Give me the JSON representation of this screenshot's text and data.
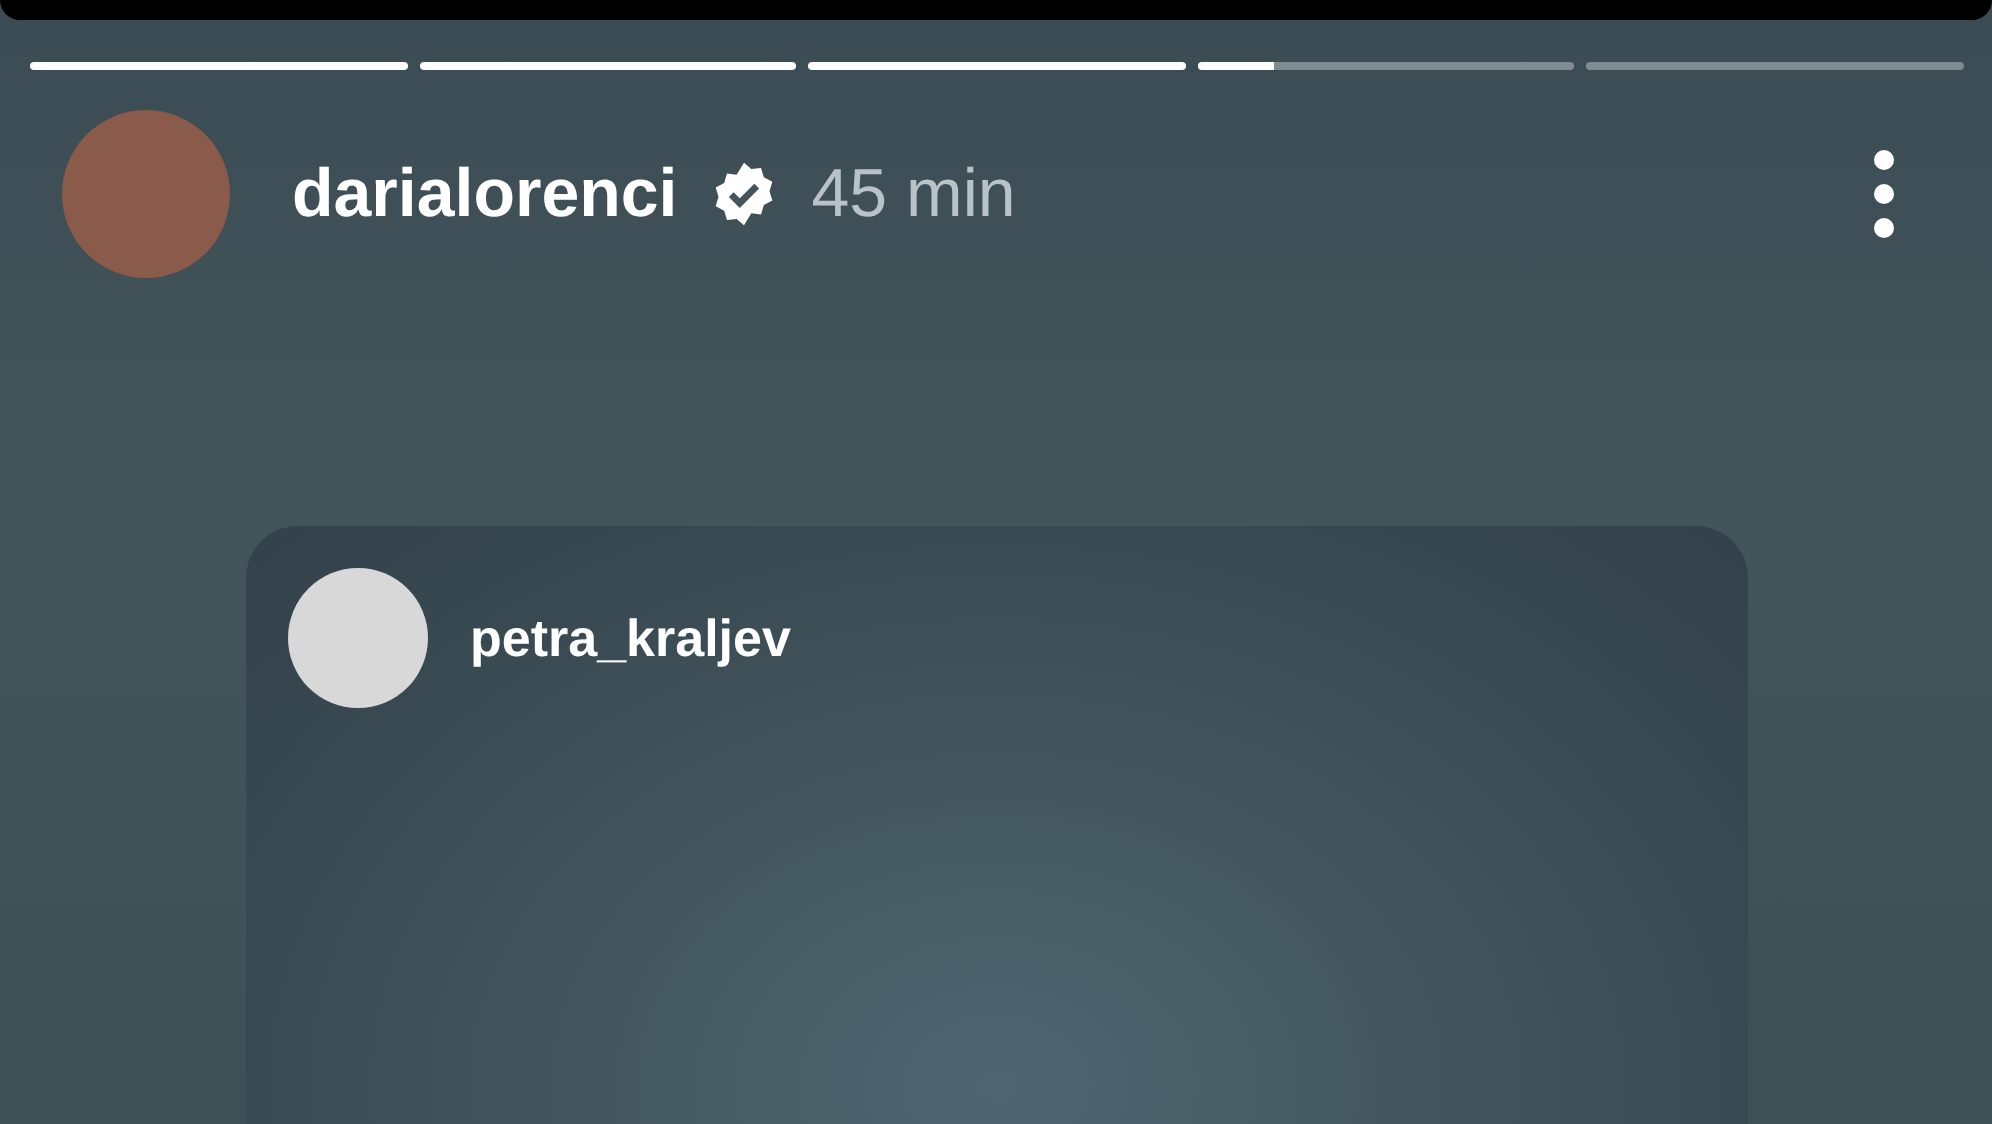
{
  "progress": [
    {
      "level": 1
    },
    {
      "level": 1
    },
    {
      "level": 1
    },
    {
      "level": 0.2
    },
    {
      "level": 0
    }
  ],
  "header": {
    "username": "darialorenci",
    "verified": true,
    "time": "45 min"
  },
  "shared_post": {
    "username": "petra_kraljev"
  }
}
